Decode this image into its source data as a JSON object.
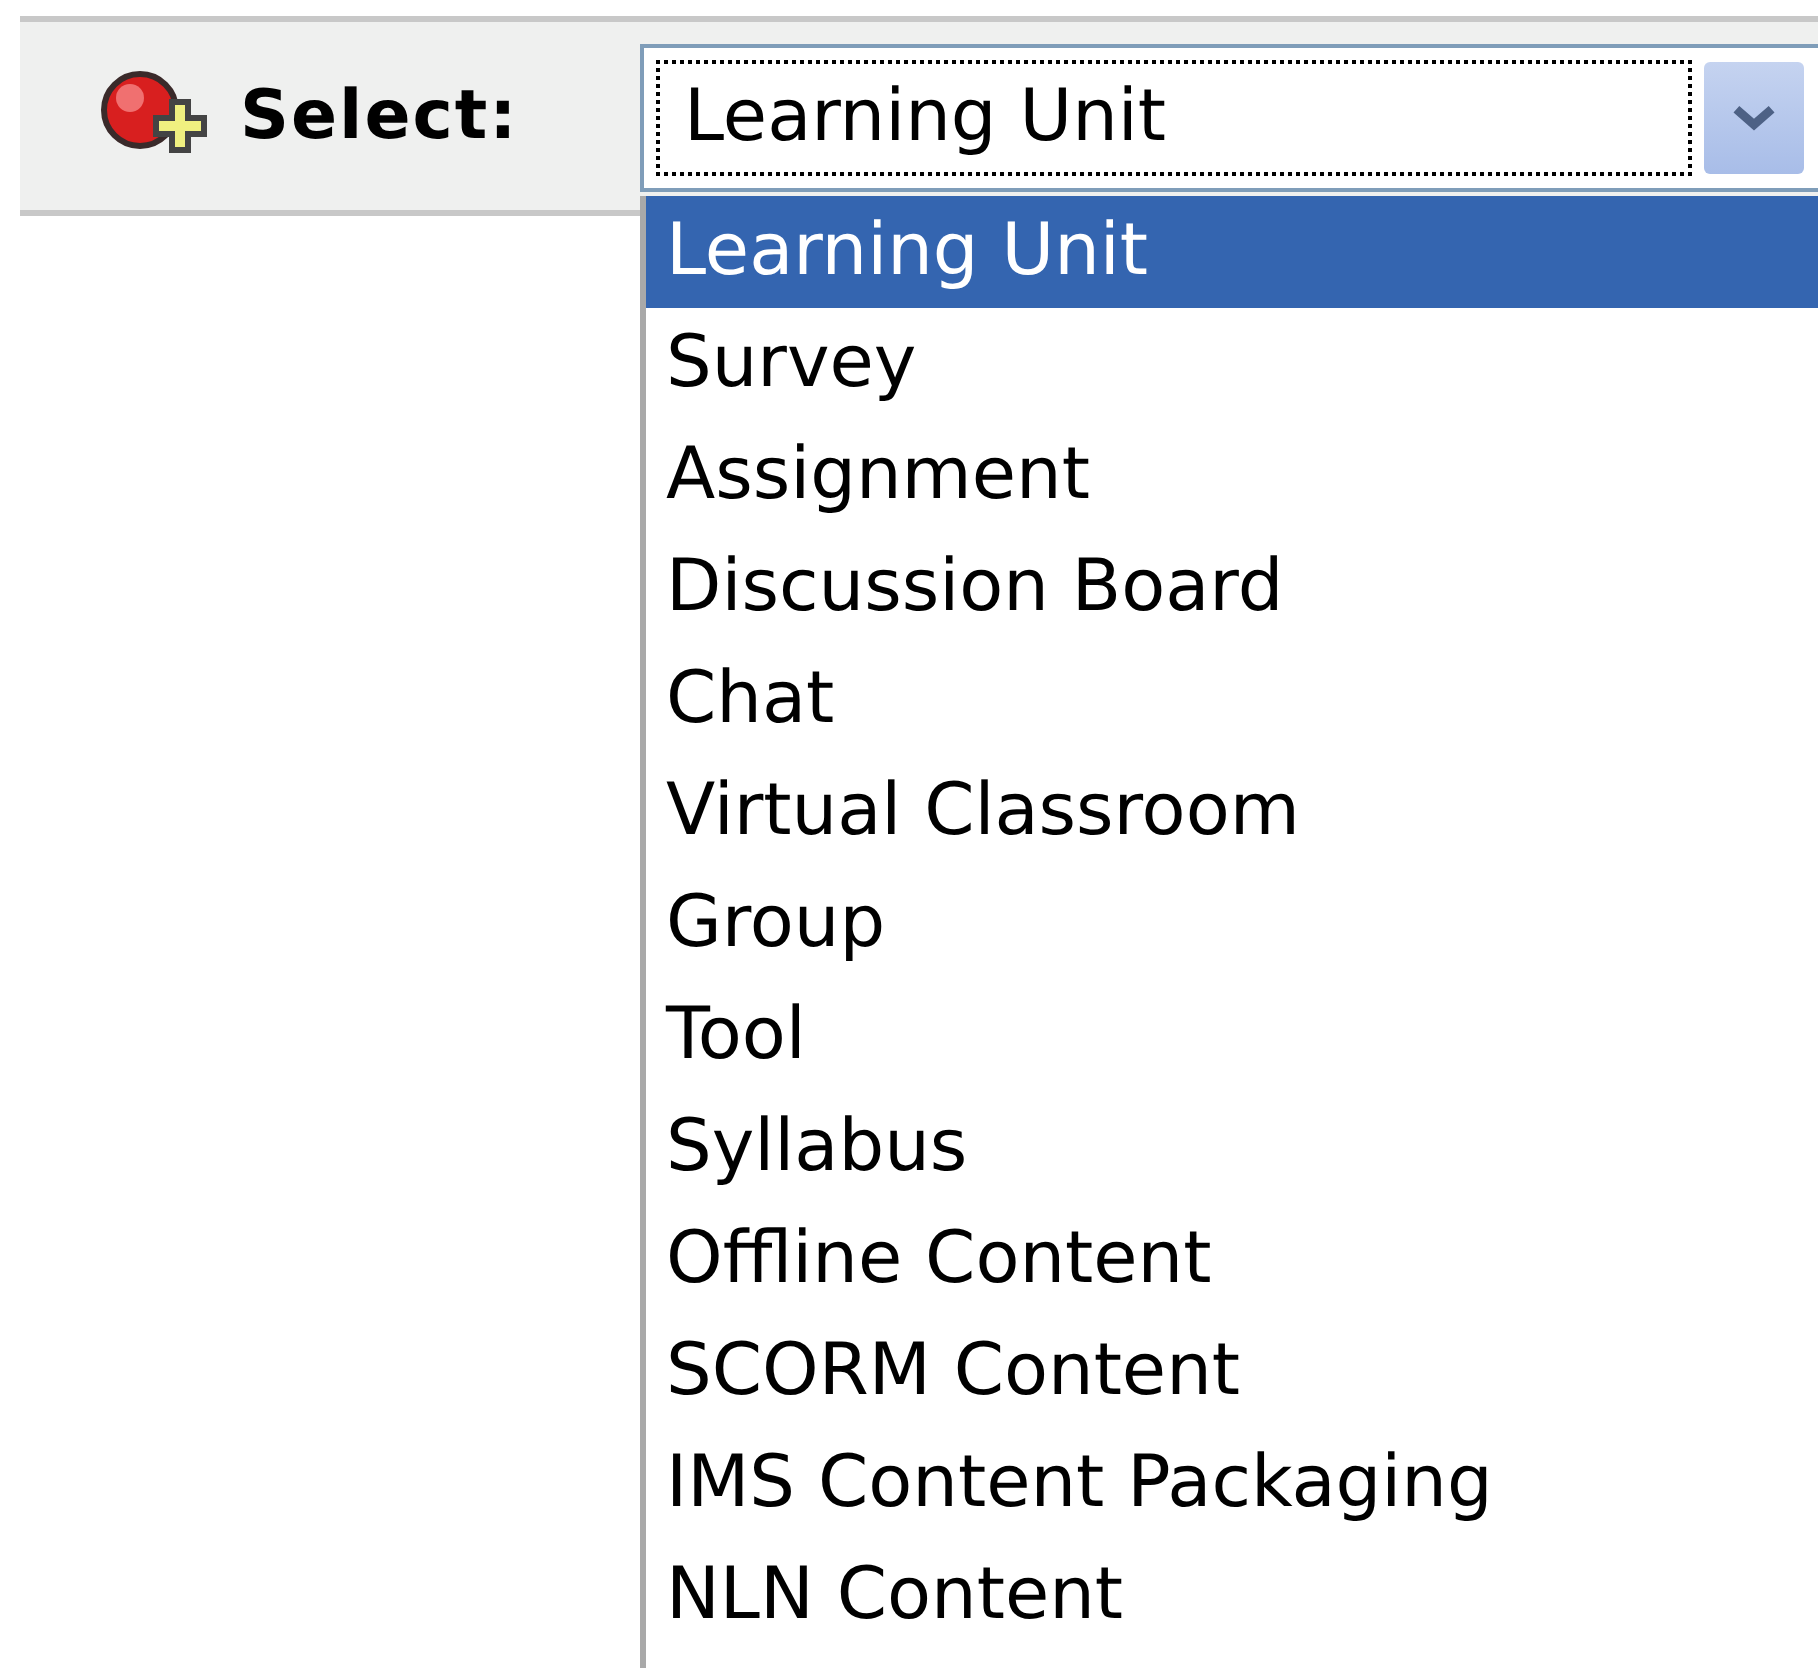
{
  "select": {
    "label": "Select:",
    "value": "Learning Unit"
  },
  "options": [
    {
      "label": "Learning Unit",
      "selected": true
    },
    {
      "label": "Survey",
      "selected": false
    },
    {
      "label": "Assignment",
      "selected": false
    },
    {
      "label": "Discussion Board",
      "selected": false
    },
    {
      "label": "Chat",
      "selected": false
    },
    {
      "label": "Virtual Classroom",
      "selected": false
    },
    {
      "label": "Group",
      "selected": false
    },
    {
      "label": "Tool",
      "selected": false
    },
    {
      "label": "Syllabus",
      "selected": false
    },
    {
      "label": "Offline Content",
      "selected": false
    },
    {
      "label": "SCORM Content",
      "selected": false
    },
    {
      "label": "IMS Content Packaging",
      "selected": false
    },
    {
      "label": "NLN Content",
      "selected": false
    }
  ]
}
